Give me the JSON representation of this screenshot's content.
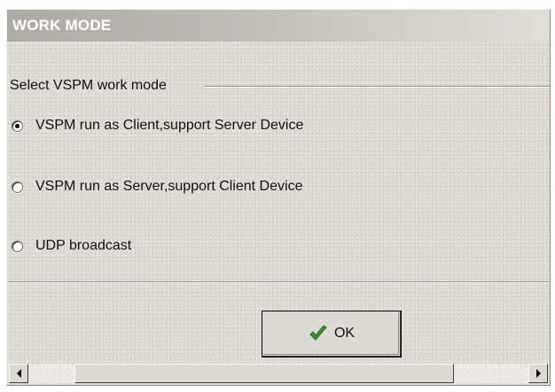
{
  "window": {
    "title": "WORK MODE"
  },
  "group": {
    "label": "Select VSPM work mode"
  },
  "options": [
    {
      "label": "VSPM run as Client,support Server Device",
      "selected": true
    },
    {
      "label": "VSPM run as Server,support Client Device",
      "selected": false
    },
    {
      "label": "UDP broadcast",
      "selected": false
    }
  ],
  "ok_button": {
    "label": "OK",
    "icon": "green-check-icon"
  },
  "scrollbar": {
    "left_icon": "arrow-left-icon",
    "right_icon": "arrow-right-icon"
  }
}
